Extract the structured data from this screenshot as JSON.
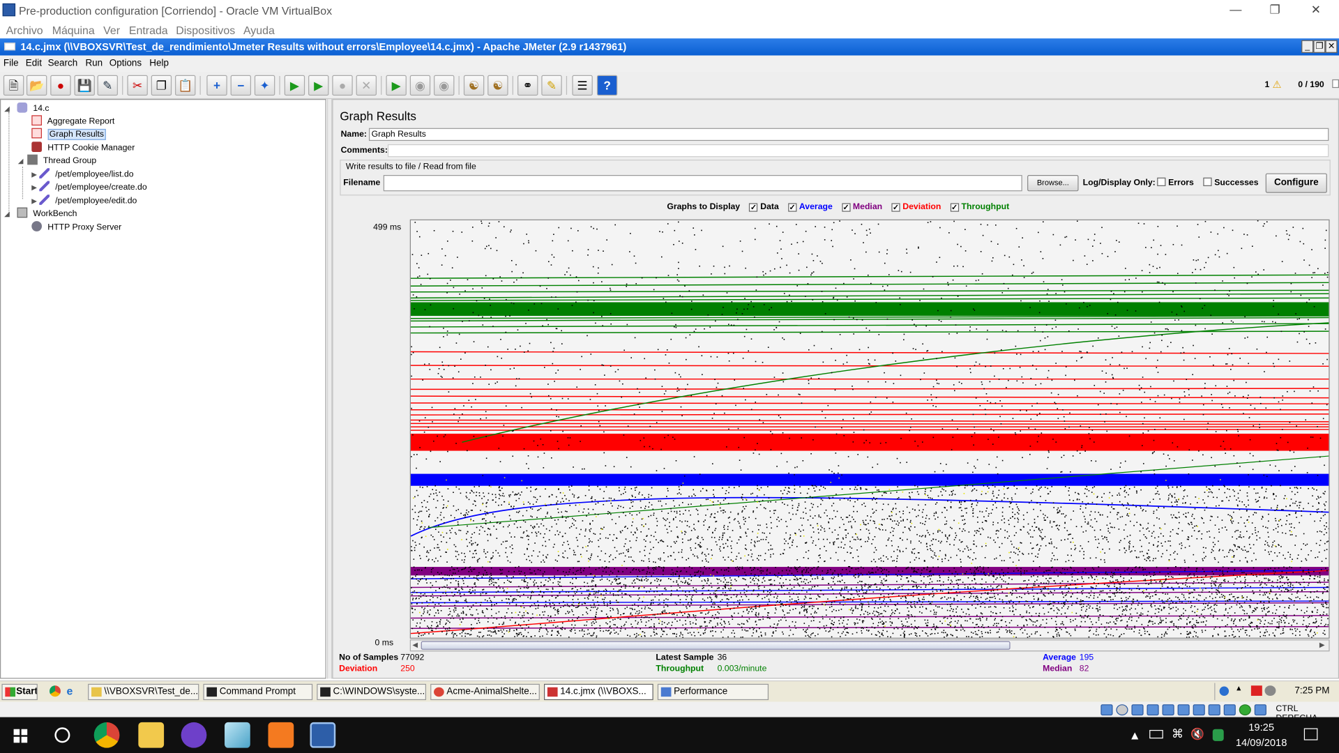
{
  "vbox": {
    "title": "Pre-production configuration [Corriendo] - Oracle VM VirtualBox",
    "menu": [
      "Archivo",
      "Máquina",
      "Ver",
      "Entrada",
      "Dispositivos",
      "Ayuda"
    ]
  },
  "jmeter": {
    "title": "14.c.jmx (\\\\VBOXSVR\\Test_de_rendimiento\\Jmeter Results without errors\\Employee\\14.c.jmx) - Apache JMeter (2.9 r1437961)",
    "menu": [
      "File",
      "Edit",
      "Search",
      "Run",
      "Options",
      "Help"
    ],
    "warning_count": "1",
    "thread_count": "0 / 190"
  },
  "tree": {
    "items": [
      {
        "label": "14.c",
        "icon": "test-plan-icon"
      },
      {
        "label": "Aggregate Report",
        "icon": "report-icon"
      },
      {
        "label": "Graph Results",
        "icon": "graph-icon"
      },
      {
        "label": "HTTP Cookie Manager",
        "icon": "cookie-icon"
      },
      {
        "label": "Thread Group",
        "icon": "thread-group-icon"
      },
      {
        "label": "/pet/employee/list.do",
        "icon": "sampler-icon"
      },
      {
        "label": "/pet/employee/create.do",
        "icon": "sampler-icon"
      },
      {
        "label": "/pet/employee/edit.do",
        "icon": "sampler-icon"
      },
      {
        "label": "WorkBench",
        "icon": "workbench-icon"
      },
      {
        "label": "HTTP Proxy Server",
        "icon": "proxy-icon"
      }
    ]
  },
  "panel": {
    "title": "Graph Results",
    "name_label": "Name:",
    "name_value": "Graph Results",
    "comments_label": "Comments:",
    "file_section": "Write results to file / Read from file",
    "filename_label": "Filename",
    "browse_label": "Browse...",
    "logdisplay_label": "Log/Display Only:",
    "errors_label": "Errors",
    "successes_label": "Successes",
    "configure_label": "Configure",
    "graphs_to_display": "Graphs to Display",
    "legend": [
      {
        "label": "Data",
        "color": "#000000"
      },
      {
        "label": "Average",
        "color": "#0000ff"
      },
      {
        "label": "Median",
        "color": "#800080"
      },
      {
        "label": "Deviation",
        "color": "#ff0000"
      },
      {
        "label": "Throughput",
        "color": "#008000"
      }
    ]
  },
  "chart_data": {
    "type": "scatter",
    "y_max_label": "499 ms",
    "y_min_label": "0 ms",
    "ylim": [
      0,
      499
    ]
  },
  "stats": {
    "samples_label": "No of Samples",
    "samples_value": "77092",
    "deviation_label": "Deviation",
    "deviation_value": "250",
    "latest_label": "Latest Sample",
    "latest_value": "36",
    "throughput_label": "Throughput",
    "throughput_value": "0.003/minute",
    "average_label": "Average",
    "average_value": "195",
    "median_label": "Median",
    "median_value": "82"
  },
  "guest_taskbar": {
    "start": "Start",
    "tasks": [
      "\\\\VBOXSVR\\Test_de...",
      "Command Prompt",
      "C:\\WINDOWS\\syste...",
      "Acme-AnimalShelte...",
      "14.c.jmx (\\\\VBOXS...",
      "Performance"
    ],
    "clock": "7:25 PM"
  },
  "vbox_status": {
    "host_key": "CTRL DERECHA"
  },
  "host_taskbar": {
    "time": "19:25",
    "date": "14/09/2018"
  }
}
